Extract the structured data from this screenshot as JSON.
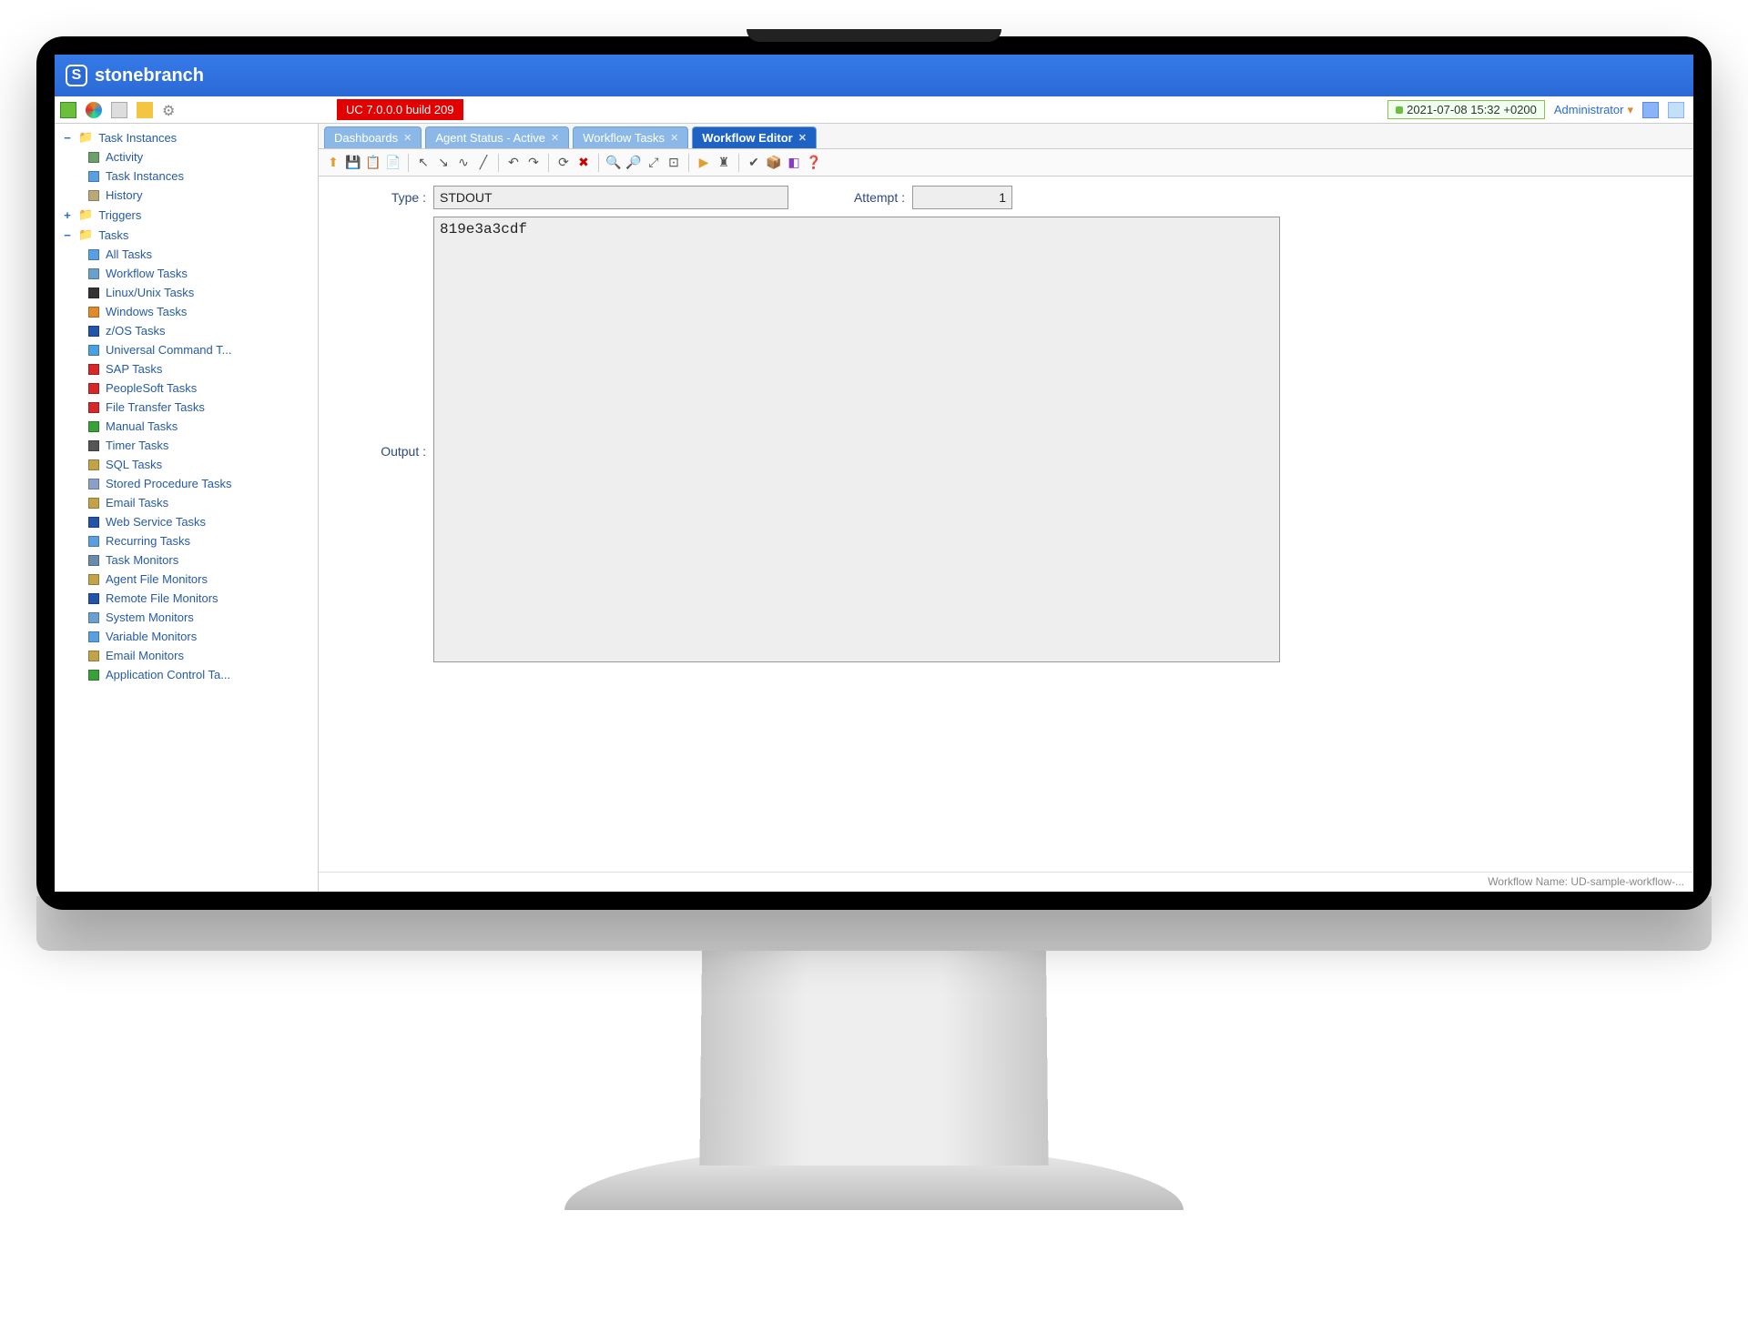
{
  "brand": "stonebranch",
  "build_badge": "UC 7.0.0.0 build 209",
  "datetime": "2021-07-08 15:32 +0200",
  "admin_label": "Administrator",
  "sidebar": {
    "groups": [
      {
        "toggle": "−",
        "label": "Task Instances",
        "children": [
          {
            "icon_color": "#6aa06a",
            "label": "Activity"
          },
          {
            "icon_color": "#5aa0e0",
            "label": "Task Instances"
          },
          {
            "icon_color": "#bba77a",
            "label": "History"
          }
        ]
      },
      {
        "toggle": "+",
        "label": "Triggers",
        "children": []
      },
      {
        "toggle": "−",
        "label": "Tasks",
        "children": [
          {
            "icon_color": "#5aa0e0",
            "label": "All Tasks"
          },
          {
            "icon_color": "#6aa0cd",
            "label": "Workflow Tasks"
          },
          {
            "icon_color": "#333333",
            "label": "Linux/Unix Tasks"
          },
          {
            "icon_color": "#e08a2a",
            "label": "Windows Tasks"
          },
          {
            "icon_color": "#2255aa",
            "label": "z/OS Tasks"
          },
          {
            "icon_color": "#4aa0e0",
            "label": "Universal Command T..."
          },
          {
            "icon_color": "#d62828",
            "label": "SAP Tasks"
          },
          {
            "icon_color": "#d62828",
            "label": "PeopleSoft Tasks"
          },
          {
            "icon_color": "#d62828",
            "label": "File Transfer Tasks"
          },
          {
            "icon_color": "#3aa03a",
            "label": "Manual Tasks"
          },
          {
            "icon_color": "#555555",
            "label": "Timer Tasks"
          },
          {
            "icon_color": "#c4a24a",
            "label": "SQL Tasks"
          },
          {
            "icon_color": "#8aa0c8",
            "label": "Stored Procedure Tasks"
          },
          {
            "icon_color": "#c4a24a",
            "label": "Email Tasks"
          },
          {
            "icon_color": "#2255aa",
            "label": "Web Service Tasks"
          },
          {
            "icon_color": "#5aa0e0",
            "label": "Recurring Tasks"
          },
          {
            "icon_color": "#6a8aaa",
            "label": "Task Monitors"
          },
          {
            "icon_color": "#c4a24a",
            "label": "Agent File Monitors"
          },
          {
            "icon_color": "#2255aa",
            "label": "Remote File Monitors"
          },
          {
            "icon_color": "#6aa0cd",
            "label": "System Monitors"
          },
          {
            "icon_color": "#5aa0e0",
            "label": "Variable Monitors"
          },
          {
            "icon_color": "#c4a24a",
            "label": "Email Monitors"
          },
          {
            "icon_color": "#3aa03a",
            "label": "Application Control Ta..."
          }
        ]
      }
    ]
  },
  "tabs": [
    {
      "label": "Dashboards",
      "active": false
    },
    {
      "label": "Agent Status - Active",
      "active": false
    },
    {
      "label": "Workflow Tasks",
      "active": false
    },
    {
      "label": "Workflow Editor",
      "active": true
    }
  ],
  "toolbar_icons": [
    "arrow-up",
    "save",
    "paste",
    "copy",
    "separator",
    "pointer",
    "connector-straight",
    "connector-curved",
    "line",
    "separator",
    "undo",
    "redo",
    "separator",
    "refresh",
    "delete",
    "separator",
    "zoom-in",
    "zoom-out",
    "zoom-fit",
    "zoom-actual",
    "separator",
    "run",
    "tree",
    "separator",
    "validate",
    "package",
    "cube-purple",
    "help"
  ],
  "fields": {
    "type_label": "Type :",
    "type_value": "STDOUT",
    "attempt_label": "Attempt :",
    "attempt_value": "1",
    "output_label": "Output :",
    "output_value": "819e3a3cdf"
  },
  "statusbar": "Workflow Name: UD-sample-workflow-..."
}
